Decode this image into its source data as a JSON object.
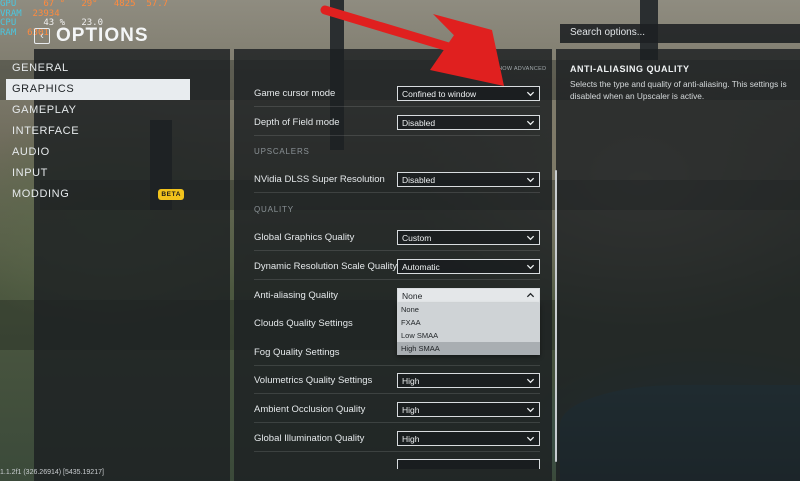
{
  "hud": [
    {
      "k": "GPU",
      "v": "67 °",
      "v2": "29°",
      "v3": "4825",
      "v4": "57.7"
    },
    {
      "k": "VRAM",
      "v": "23934",
      "v2": "",
      "v3": "",
      "v4": ""
    },
    {
      "k": "CPU",
      "v": "43 %",
      "v2": "23.0",
      "v3": "",
      "v4": ""
    },
    {
      "k": "RAM",
      "v": "6301",
      "v2": "",
      "v3": "",
      "v4": ""
    }
  ],
  "title": "OPTIONS",
  "search": {
    "placeholder": "Search options..."
  },
  "nav": [
    {
      "label": "GENERAL"
    },
    {
      "label": "GRAPHICS"
    },
    {
      "label": "GAMEPLAY"
    },
    {
      "label": "INTERFACE"
    },
    {
      "label": "AUDIO"
    },
    {
      "label": "INPUT"
    },
    {
      "label": "MODDING",
      "badge": "BETA"
    }
  ],
  "show_advanced": "SHOW ADVANCED",
  "settings": {
    "game_cursor_mode": {
      "label": "Game cursor mode",
      "value": "Confined to window"
    },
    "depth_of_field": {
      "label": "Depth of Field mode",
      "value": "Disabled"
    },
    "upscalers_header": "UPSCALERS",
    "dlss": {
      "label": "NVidia DLSS Super Resolution",
      "value": "Disabled"
    },
    "quality_header": "QUALITY",
    "global_graphics": {
      "label": "Global Graphics Quality",
      "value": "Custom"
    },
    "dynamic_res": {
      "label": "Dynamic Resolution Scale Quality",
      "value": "Automatic"
    },
    "anti_aliasing": {
      "label": "Anti-aliasing Quality",
      "value": "None"
    },
    "clouds": {
      "label": "Clouds Quality Settings"
    },
    "fog": {
      "label": "Fog Quality Settings"
    },
    "volumetrics": {
      "label": "Volumetrics Quality Settings",
      "value": "High"
    },
    "ambient_occlusion": {
      "label": "Ambient Occlusion Quality",
      "value": "High"
    },
    "global_illumination": {
      "label": "Global Illumination Quality",
      "value": "High"
    }
  },
  "aa_options": [
    "None",
    "FXAA",
    "Low SMAA",
    "High SMAA"
  ],
  "description": {
    "title": "ANTI-ALIASING QUALITY",
    "text": "Selects the type and quality of anti-aliasing.  This settings is disabled when an Upscaler is active."
  },
  "footer": "1.1.2f1 (326.26914) [5435.19217]"
}
